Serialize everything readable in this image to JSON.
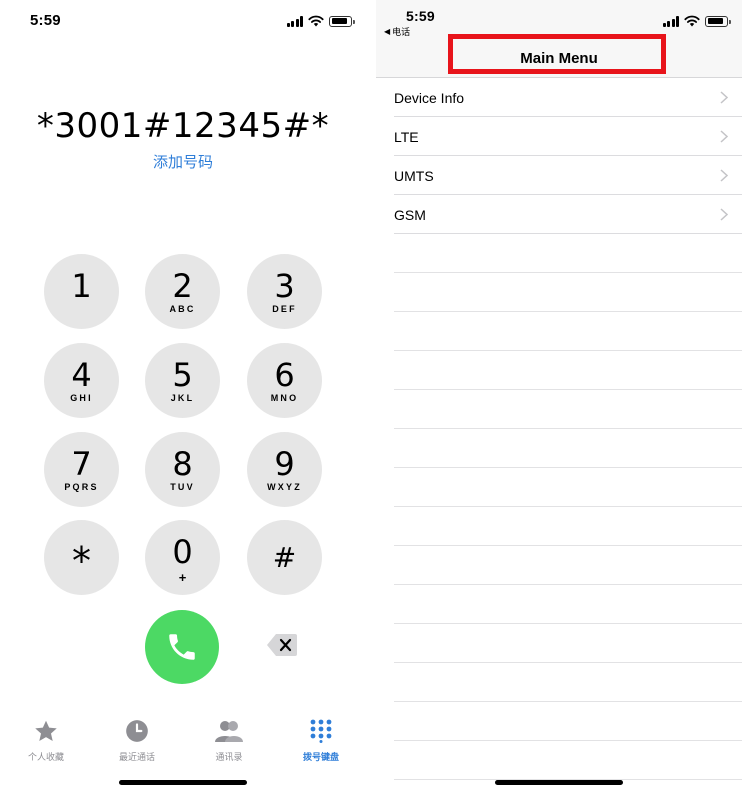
{
  "left_screen": {
    "status_bar": {
      "time": "5:59"
    },
    "dialer": {
      "number": "*3001#12345#*",
      "add_number_label": "添加号码"
    },
    "keypad": [
      {
        "digit": "1",
        "letters": ""
      },
      {
        "digit": "2",
        "letters": "ABC"
      },
      {
        "digit": "3",
        "letters": "DEF"
      },
      {
        "digit": "4",
        "letters": "GHI"
      },
      {
        "digit": "5",
        "letters": "JKL"
      },
      {
        "digit": "6",
        "letters": "MNO"
      },
      {
        "digit": "7",
        "letters": "PQRS"
      },
      {
        "digit": "8",
        "letters": "TUV"
      },
      {
        "digit": "9",
        "letters": "WXYZ"
      },
      {
        "digit": "*",
        "letters": ""
      },
      {
        "digit": "0",
        "letters": "+"
      },
      {
        "digit": "#",
        "letters": ""
      }
    ],
    "call_button_icon": "phone-icon",
    "delete_button_icon": "delete-backspace-icon",
    "tab_bar": [
      {
        "label": "个人收藏",
        "icon": "star-icon",
        "active": false
      },
      {
        "label": "最近通话",
        "icon": "clock-icon",
        "active": false
      },
      {
        "label": "通讯录",
        "icon": "contacts-icon",
        "active": false
      },
      {
        "label": "拨号键盘",
        "icon": "keypad-icon",
        "active": true
      }
    ],
    "colors": {
      "accent": "#2f7ed8",
      "call_green": "#4cd964",
      "key_gray": "#e6e6e6"
    }
  },
  "right_screen": {
    "status_bar": {
      "time": "5:59"
    },
    "back_label": "电话",
    "title": "Main Menu",
    "menu_items": [
      {
        "label": "Device Info"
      },
      {
        "label": "LTE"
      },
      {
        "label": "UMTS"
      },
      {
        "label": "GSM"
      }
    ],
    "highlight_color": "#e8141b"
  }
}
